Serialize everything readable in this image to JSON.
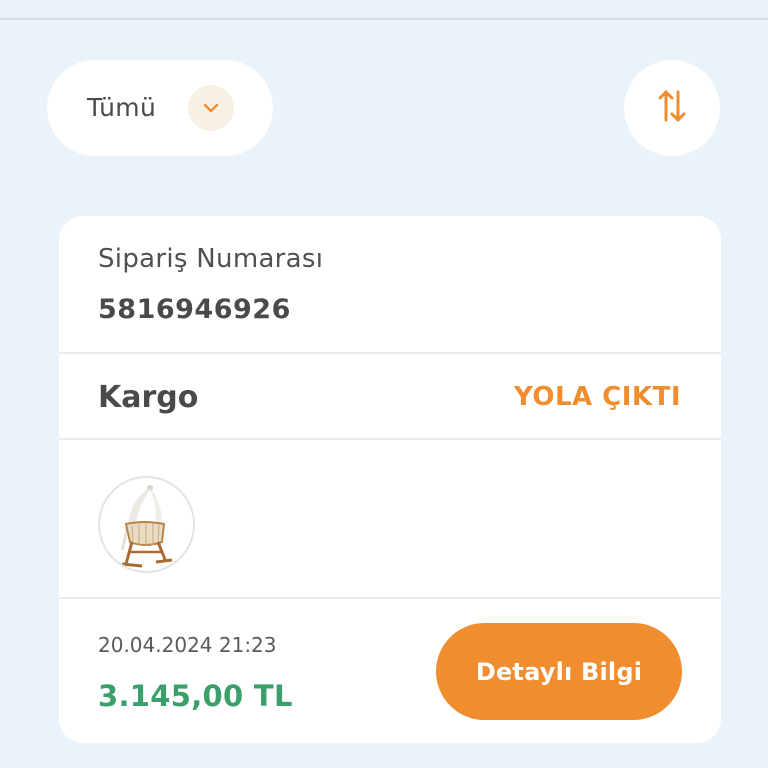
{
  "filter": {
    "selected": "Tümü",
    "chevron_icon": "chevron-down-icon",
    "sort_icon": "sort-arrows-icon"
  },
  "order": {
    "number_label": "Sipariş Numarası",
    "number": "5816946926",
    "shipping_label": "Kargo",
    "shipping_status": "YOLA ÇIKTI",
    "product_image": "baby-cradle-image",
    "date": "20.04.2024 21:23",
    "total": "3.145,00 TL",
    "detail_button": "Detaylı Bilgi"
  },
  "colors": {
    "accent": "#ef8d2f",
    "price": "#3a9f6a",
    "background": "#eaf2fa"
  }
}
